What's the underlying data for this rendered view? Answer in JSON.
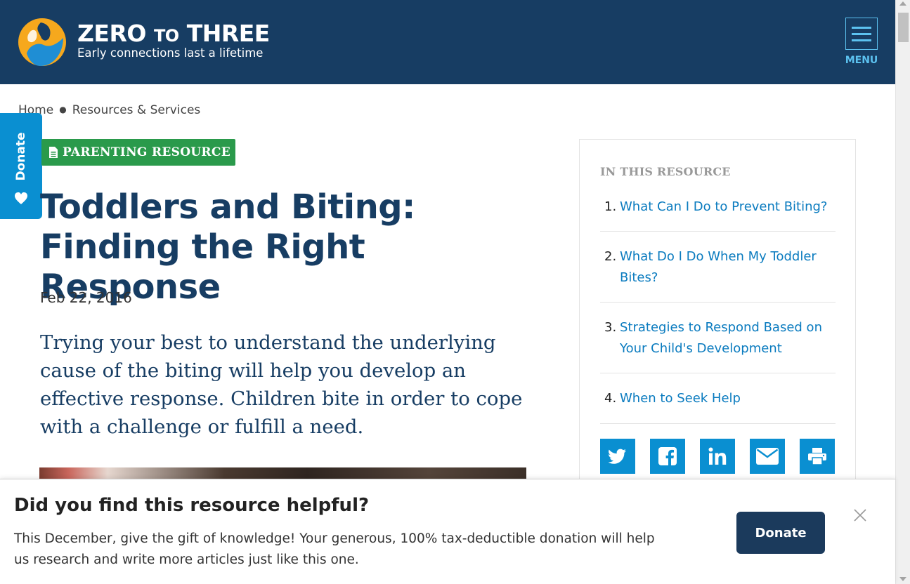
{
  "header": {
    "logo_title_a": "ZERO",
    "logo_title_to": "TO",
    "logo_title_b": "THREE",
    "logo_tagline": "Early connections last a lifetime",
    "menu_label": "MENU",
    "bg_color": "#173d63",
    "accent_color": "#5cc2f0"
  },
  "breadcrumb": {
    "items": [
      "Home",
      "Resources & Services"
    ]
  },
  "side_donate": {
    "label": "Donate",
    "icon": "heart-icon"
  },
  "article": {
    "tag": "PARENTING RESOURCE",
    "tag_icon": "document-icon",
    "title": "Toddlers and Biting: Finding the Right Response",
    "date": "Feb 22, 2016",
    "intro": "Trying your best to understand the underlying cause of the biting will help you develop an effective response. Children bite in order to cope with a challenge or fulfill a need."
  },
  "sidebar": {
    "heading": "IN THIS RESOURCE",
    "toc": [
      {
        "num": "1.",
        "label": "What Can I Do to Prevent Biting?"
      },
      {
        "num": "2.",
        "label": "What Do I Do When My Toddler Bites?"
      },
      {
        "num": "3.",
        "label": "Strategies to Respond Based on Your Child's Development"
      },
      {
        "num": "4.",
        "label": "When to Seek Help"
      }
    ],
    "share_icons": [
      "twitter-icon",
      "facebook-icon",
      "linkedin-icon",
      "email-icon",
      "print-icon"
    ]
  },
  "banner": {
    "title": "Did you find this resource helpful?",
    "text": "This December, give the gift of knowledge! Your generous, 100% tax-deductible donation will help us research and write more articles just like this one.",
    "donate_label": "Donate"
  }
}
